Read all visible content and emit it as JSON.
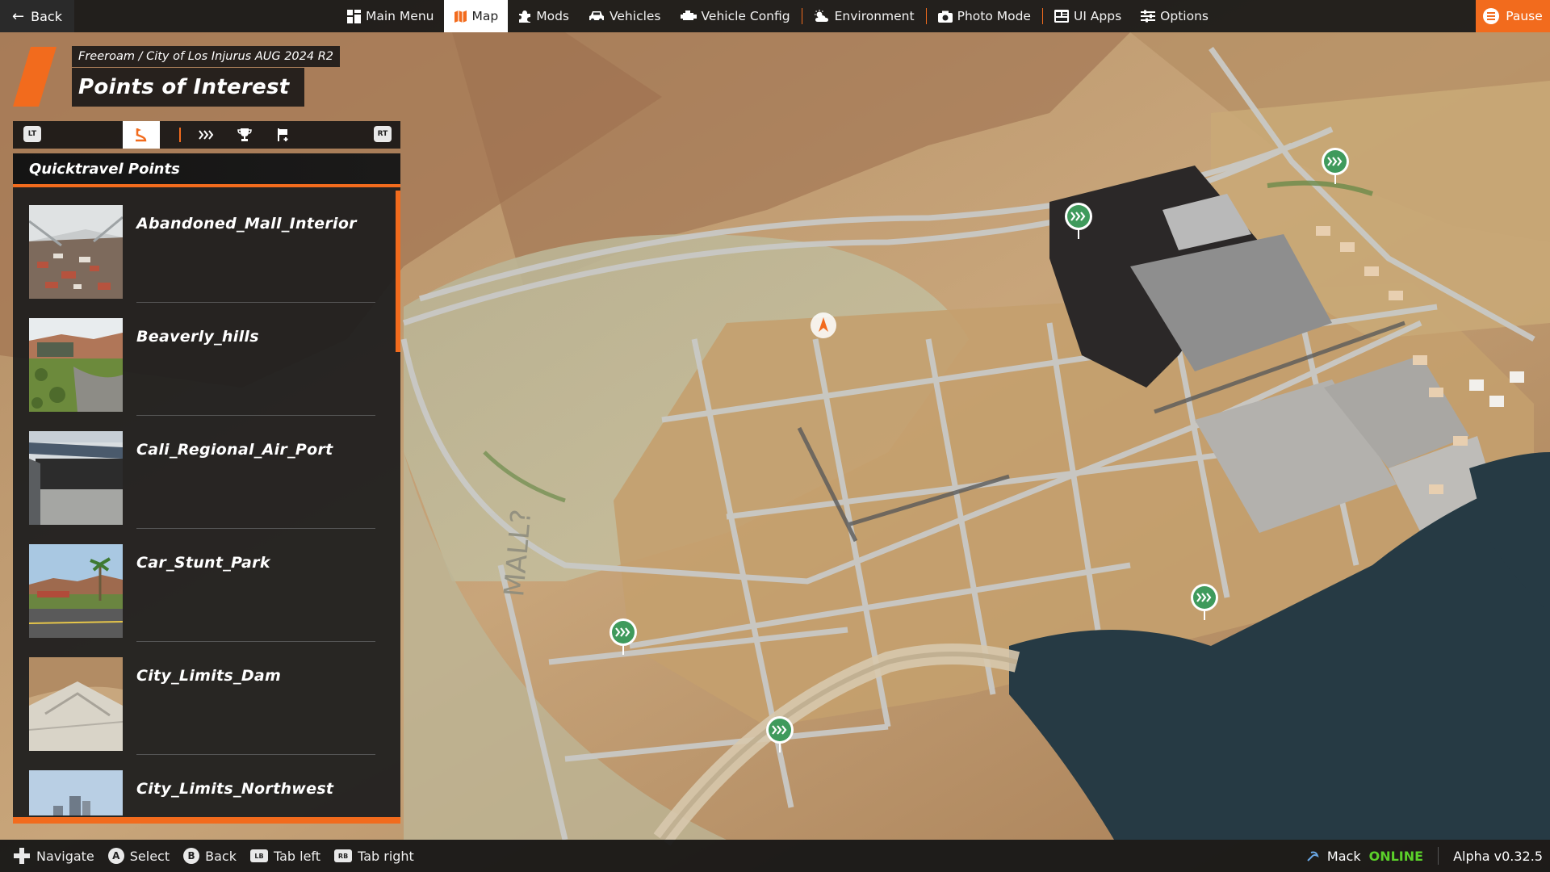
{
  "topbar": {
    "back_label": "Back",
    "nav_items": [
      {
        "label": "Main Menu",
        "icon": "dashboard-icon"
      },
      {
        "label": "Map",
        "icon": "map-icon",
        "active": true
      },
      {
        "label": "Mods",
        "icon": "puzzle-icon"
      },
      {
        "label": "Vehicles",
        "icon": "car-icon"
      },
      {
        "label": "Vehicle Config",
        "icon": "engine-icon"
      },
      {
        "label": "Environment",
        "icon": "weather-icon"
      },
      {
        "label": "Photo Mode",
        "icon": "camera-icon"
      },
      {
        "label": "UI Apps",
        "icon": "apps-icon"
      },
      {
        "label": "Options",
        "icon": "sliders-icon"
      }
    ],
    "pause_label": "Pause"
  },
  "header": {
    "breadcrumb": "Freeroam / City of Los Injurus AUG 2024 R2",
    "title": "Points of Interest"
  },
  "tabs": {
    "left_shoulder": "LT",
    "right_shoulder": "RT",
    "items": [
      "spawn-point-icon",
      "quicktravel-icon",
      "trophy-icon",
      "flag-icon"
    ],
    "active_index": 0
  },
  "panel": {
    "heading": "Quicktravel Points",
    "items": [
      {
        "name": "Abandoned_Mall_Interior"
      },
      {
        "name": "Beaverly_hills"
      },
      {
        "name": "Cali_Regional_Air_Port"
      },
      {
        "name": "Car_Stunt_Park"
      },
      {
        "name": "City_Limits_Dam"
      },
      {
        "name": "City_Limits_Northwest"
      }
    ]
  },
  "bottombar": {
    "hints": [
      {
        "glyph": "dpad-icon",
        "label": "Navigate"
      },
      {
        "glyph": "A",
        "label": "Select"
      },
      {
        "glyph": "B",
        "label": "Back"
      },
      {
        "glyph": "LB",
        "label": "Tab left"
      },
      {
        "glyph": "RB",
        "label": "Tab right"
      }
    ],
    "user": "Mack",
    "status": "ONLINE",
    "version": "Alpha v0.32.5"
  },
  "map": {
    "ground_text": "MALL?"
  },
  "colors": {
    "accent": "#f26b1d",
    "online": "#5bd12a",
    "marker": "#3f9a5c"
  }
}
